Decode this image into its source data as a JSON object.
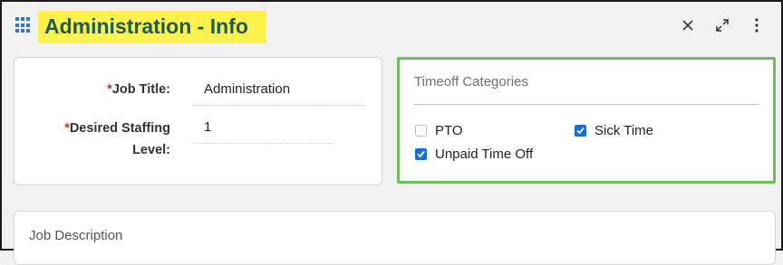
{
  "header": {
    "icon": "grid-apps-icon",
    "title": "Administration - Info",
    "actions": [
      {
        "name": "close-icon",
        "symbol": "×"
      },
      {
        "name": "expand-icon",
        "symbol": "⤢"
      },
      {
        "name": "more-options-icon",
        "symbol": "⋮"
      }
    ],
    "highlight_color": "#fdf14e"
  },
  "form": {
    "required_mark": "*",
    "job_title_label": "Job Title:",
    "job_title_value": "Administration",
    "staffing_label_line1": "Desired Staffing",
    "staffing_label_line2": "Level:",
    "staffing_value": "1"
  },
  "timeoff": {
    "title": "Timeoff Categories",
    "border_color": "#6cbf5b",
    "categories": [
      {
        "label": "PTO",
        "checked": false
      },
      {
        "label": "Sick Time",
        "checked": true
      },
      {
        "label": "Unpaid Time Off",
        "checked": true
      }
    ]
  },
  "job_description": {
    "label": "Job Description"
  }
}
